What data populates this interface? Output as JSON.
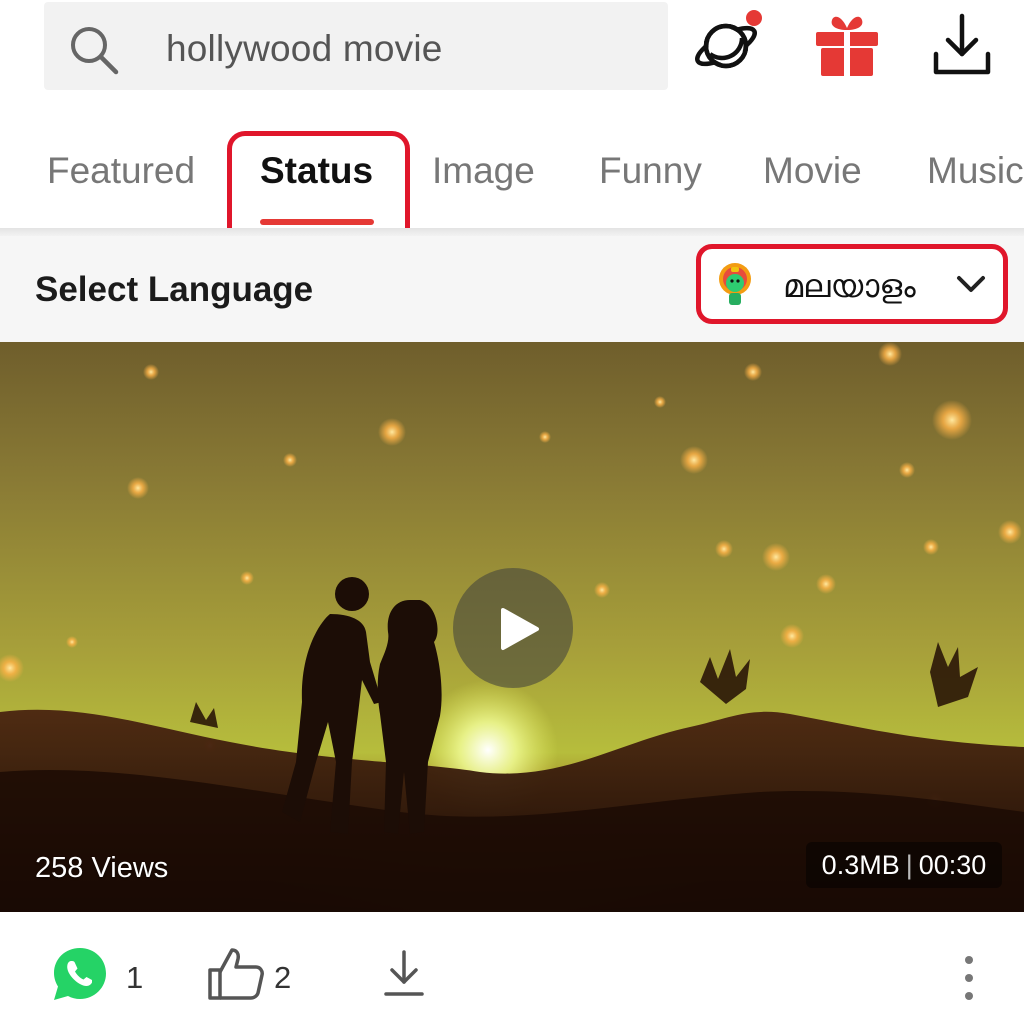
{
  "search": {
    "query": "hollywood movie",
    "icon": "search-icon"
  },
  "header_icons": {
    "planet": "planet-icon",
    "planet_badge_color": "#e53935",
    "gift": "gift-icon",
    "download": "download-icon"
  },
  "tabs": [
    {
      "label": "Featured",
      "active": false
    },
    {
      "label": "Status",
      "active": true
    },
    {
      "label": "Image",
      "active": false
    },
    {
      "label": "Funny",
      "active": false
    },
    {
      "label": "Movie",
      "active": false
    },
    {
      "label": "Music",
      "active": false
    }
  ],
  "language": {
    "title": "Select Language",
    "selected": "മലയാളം",
    "icon": "kathakali-icon"
  },
  "video": {
    "views": "258 Views",
    "size": "0.3MB",
    "duration": "00:30"
  },
  "actions": {
    "whatsapp_count": "1",
    "like_count": "2"
  },
  "colors": {
    "accent": "#e53935",
    "highlight": "#e0162b",
    "whatsapp": "#25d366"
  }
}
